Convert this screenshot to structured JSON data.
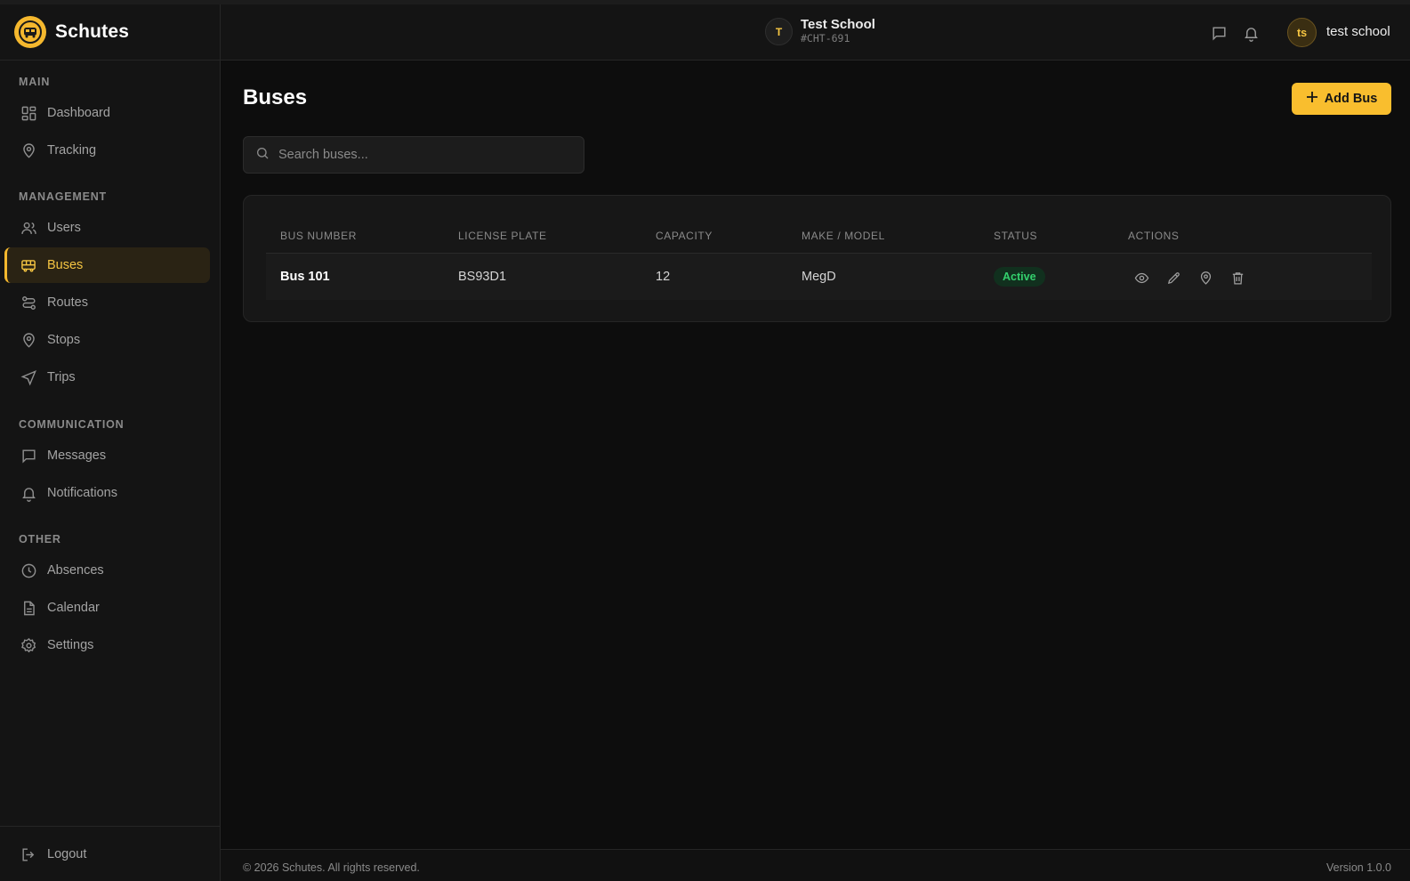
{
  "brand": {
    "name": "Schutes"
  },
  "sidebar": {
    "sections": [
      {
        "title": "MAIN"
      },
      {
        "title": "MANAGEMENT"
      },
      {
        "title": "COMMUNICATION"
      },
      {
        "title": "OTHER"
      }
    ],
    "items": [
      {
        "label": "Dashboard",
        "icon": "dashboard-icon"
      },
      {
        "label": "Tracking",
        "icon": "map-pin-icon"
      },
      {
        "label": "Users",
        "icon": "users-icon"
      },
      {
        "label": "Buses",
        "icon": "bus-icon",
        "active": true
      },
      {
        "label": "Routes",
        "icon": "route-icon"
      },
      {
        "label": "Stops",
        "icon": "map-pin-icon"
      },
      {
        "label": "Trips",
        "icon": "navigation-icon"
      },
      {
        "label": "Messages",
        "icon": "message-icon"
      },
      {
        "label": "Notifications",
        "icon": "bell-icon"
      },
      {
        "label": "Absences",
        "icon": "clock-icon"
      },
      {
        "label": "Calendar",
        "icon": "file-icon"
      },
      {
        "label": "Settings",
        "icon": "gear-icon"
      }
    ],
    "logout_label": "Logout"
  },
  "header": {
    "school_initial": "T",
    "school_name": "Test School",
    "school_code": "#CHT-691",
    "user_initials": "ts",
    "user_name": "test school"
  },
  "main": {
    "title": "Buses",
    "add_button_label": "Add Bus",
    "search_placeholder": "Search buses...",
    "columns": [
      "BUS NUMBER",
      "LICENSE PLATE",
      "CAPACITY",
      "MAKE / MODEL",
      "STATUS",
      "ACTIONS"
    ],
    "rows": [
      {
        "bus_number": "Bus 101",
        "license_plate": "BS93D1",
        "capacity": "12",
        "make_model": "MegD",
        "status": "Active"
      }
    ]
  },
  "footer": {
    "copyright": "© 2026 Schutes. All rights reserved.",
    "version": "Version 1.0.0"
  },
  "colors": {
    "accent": "#f9be2e",
    "status_active": "#34d06d",
    "background": "#0d0d0d"
  }
}
